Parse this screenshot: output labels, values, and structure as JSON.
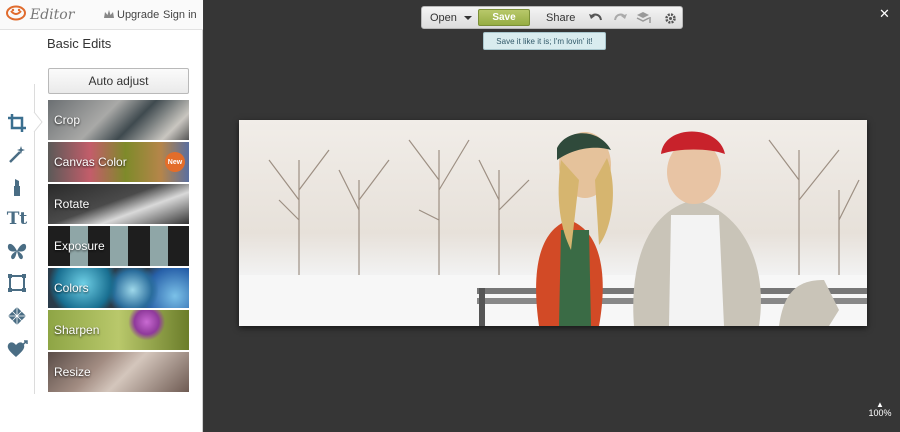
{
  "app": {
    "logo_text": "Editor",
    "upgrade_label": "Upgrade",
    "signin_label": "Sign in"
  },
  "panel": {
    "title": "Basic Edits",
    "auto_adjust_label": "Auto adjust",
    "items": [
      {
        "label": "Crop"
      },
      {
        "label": "Canvas Color",
        "badge": "New"
      },
      {
        "label": "Rotate"
      },
      {
        "label": "Exposure"
      },
      {
        "label": "Colors"
      },
      {
        "label": "Sharpen"
      },
      {
        "label": "Resize"
      }
    ]
  },
  "toolbar": {
    "open_label": "Open",
    "save_label": "Save",
    "share_label": "Share",
    "tooltip": "Save it like it is; I'm lovin' it!"
  },
  "zoom_label": "100%",
  "colors": {
    "accent_save": "#a5bb4f",
    "icon_blue": "#4a6d84",
    "badge": "#e36d2a"
  }
}
